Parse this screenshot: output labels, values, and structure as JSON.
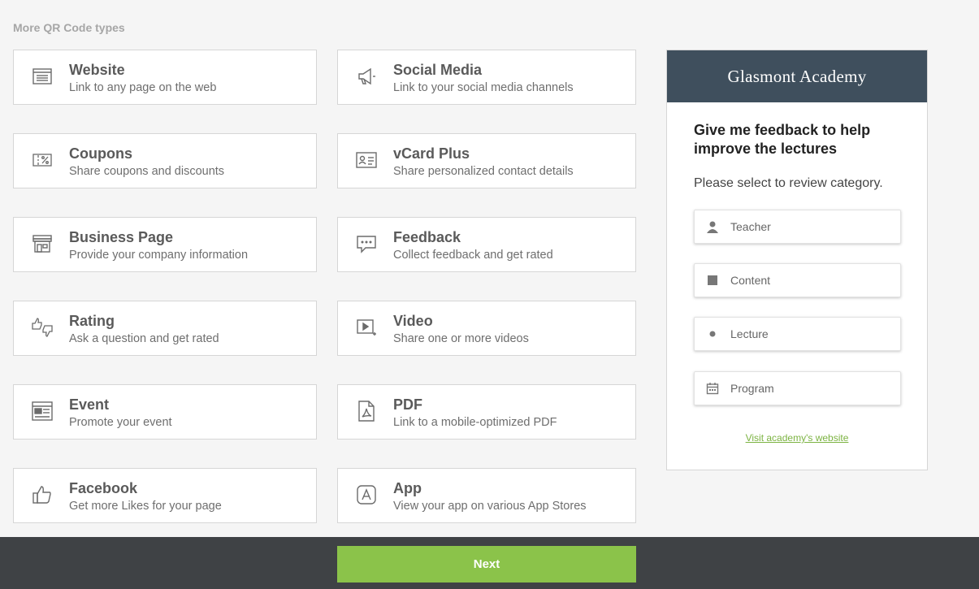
{
  "section_title": "More QR Code types",
  "qr_types": [
    {
      "title": "Website",
      "desc": "Link to any page on the web",
      "icon": "website-icon"
    },
    {
      "title": "Social Media",
      "desc": "Link to your social media channels",
      "icon": "megaphone-icon"
    },
    {
      "title": "Coupons",
      "desc": "Share coupons and discounts",
      "icon": "coupon-icon"
    },
    {
      "title": "vCard Plus",
      "desc": "Share personalized contact details",
      "icon": "contact-card-icon"
    },
    {
      "title": "Business Page",
      "desc": "Provide your company information",
      "icon": "storefront-icon"
    },
    {
      "title": "Feedback",
      "desc": "Collect feedback and get rated",
      "icon": "chat-bubble-icon"
    },
    {
      "title": "Rating",
      "desc": "Ask a question and get rated",
      "icon": "thumbs-up-down-icon"
    },
    {
      "title": "Video",
      "desc": "Share one or more videos",
      "icon": "video-icon"
    },
    {
      "title": "Event",
      "desc": "Promote your event",
      "icon": "event-icon"
    },
    {
      "title": "PDF",
      "desc": "Link to a mobile-optimized PDF",
      "icon": "pdf-icon"
    },
    {
      "title": "Facebook",
      "desc": "Get more Likes for your page",
      "icon": "thumbs-up-icon"
    },
    {
      "title": "App",
      "desc": "View your app on various App Stores",
      "icon": "app-store-icon"
    }
  ],
  "preview": {
    "title": "Glasmont Academy",
    "heading": "Give me feedback to help improve the lectures",
    "subheading": "Please select to review category.",
    "categories": [
      {
        "label": "Teacher",
        "icon": "person-icon"
      },
      {
        "label": "Content",
        "icon": "square-icon"
      },
      {
        "label": "Lecture",
        "icon": "dot-icon"
      },
      {
        "label": "Program",
        "icon": "calendar-icon"
      }
    ],
    "link": "Visit academy's website"
  },
  "next_label": "Next",
  "colors": {
    "header_bg": "#3f4f5d",
    "bottom_bar": "#3f4245",
    "accent_green": "#8bc34a",
    "link_green": "#7cb342"
  }
}
